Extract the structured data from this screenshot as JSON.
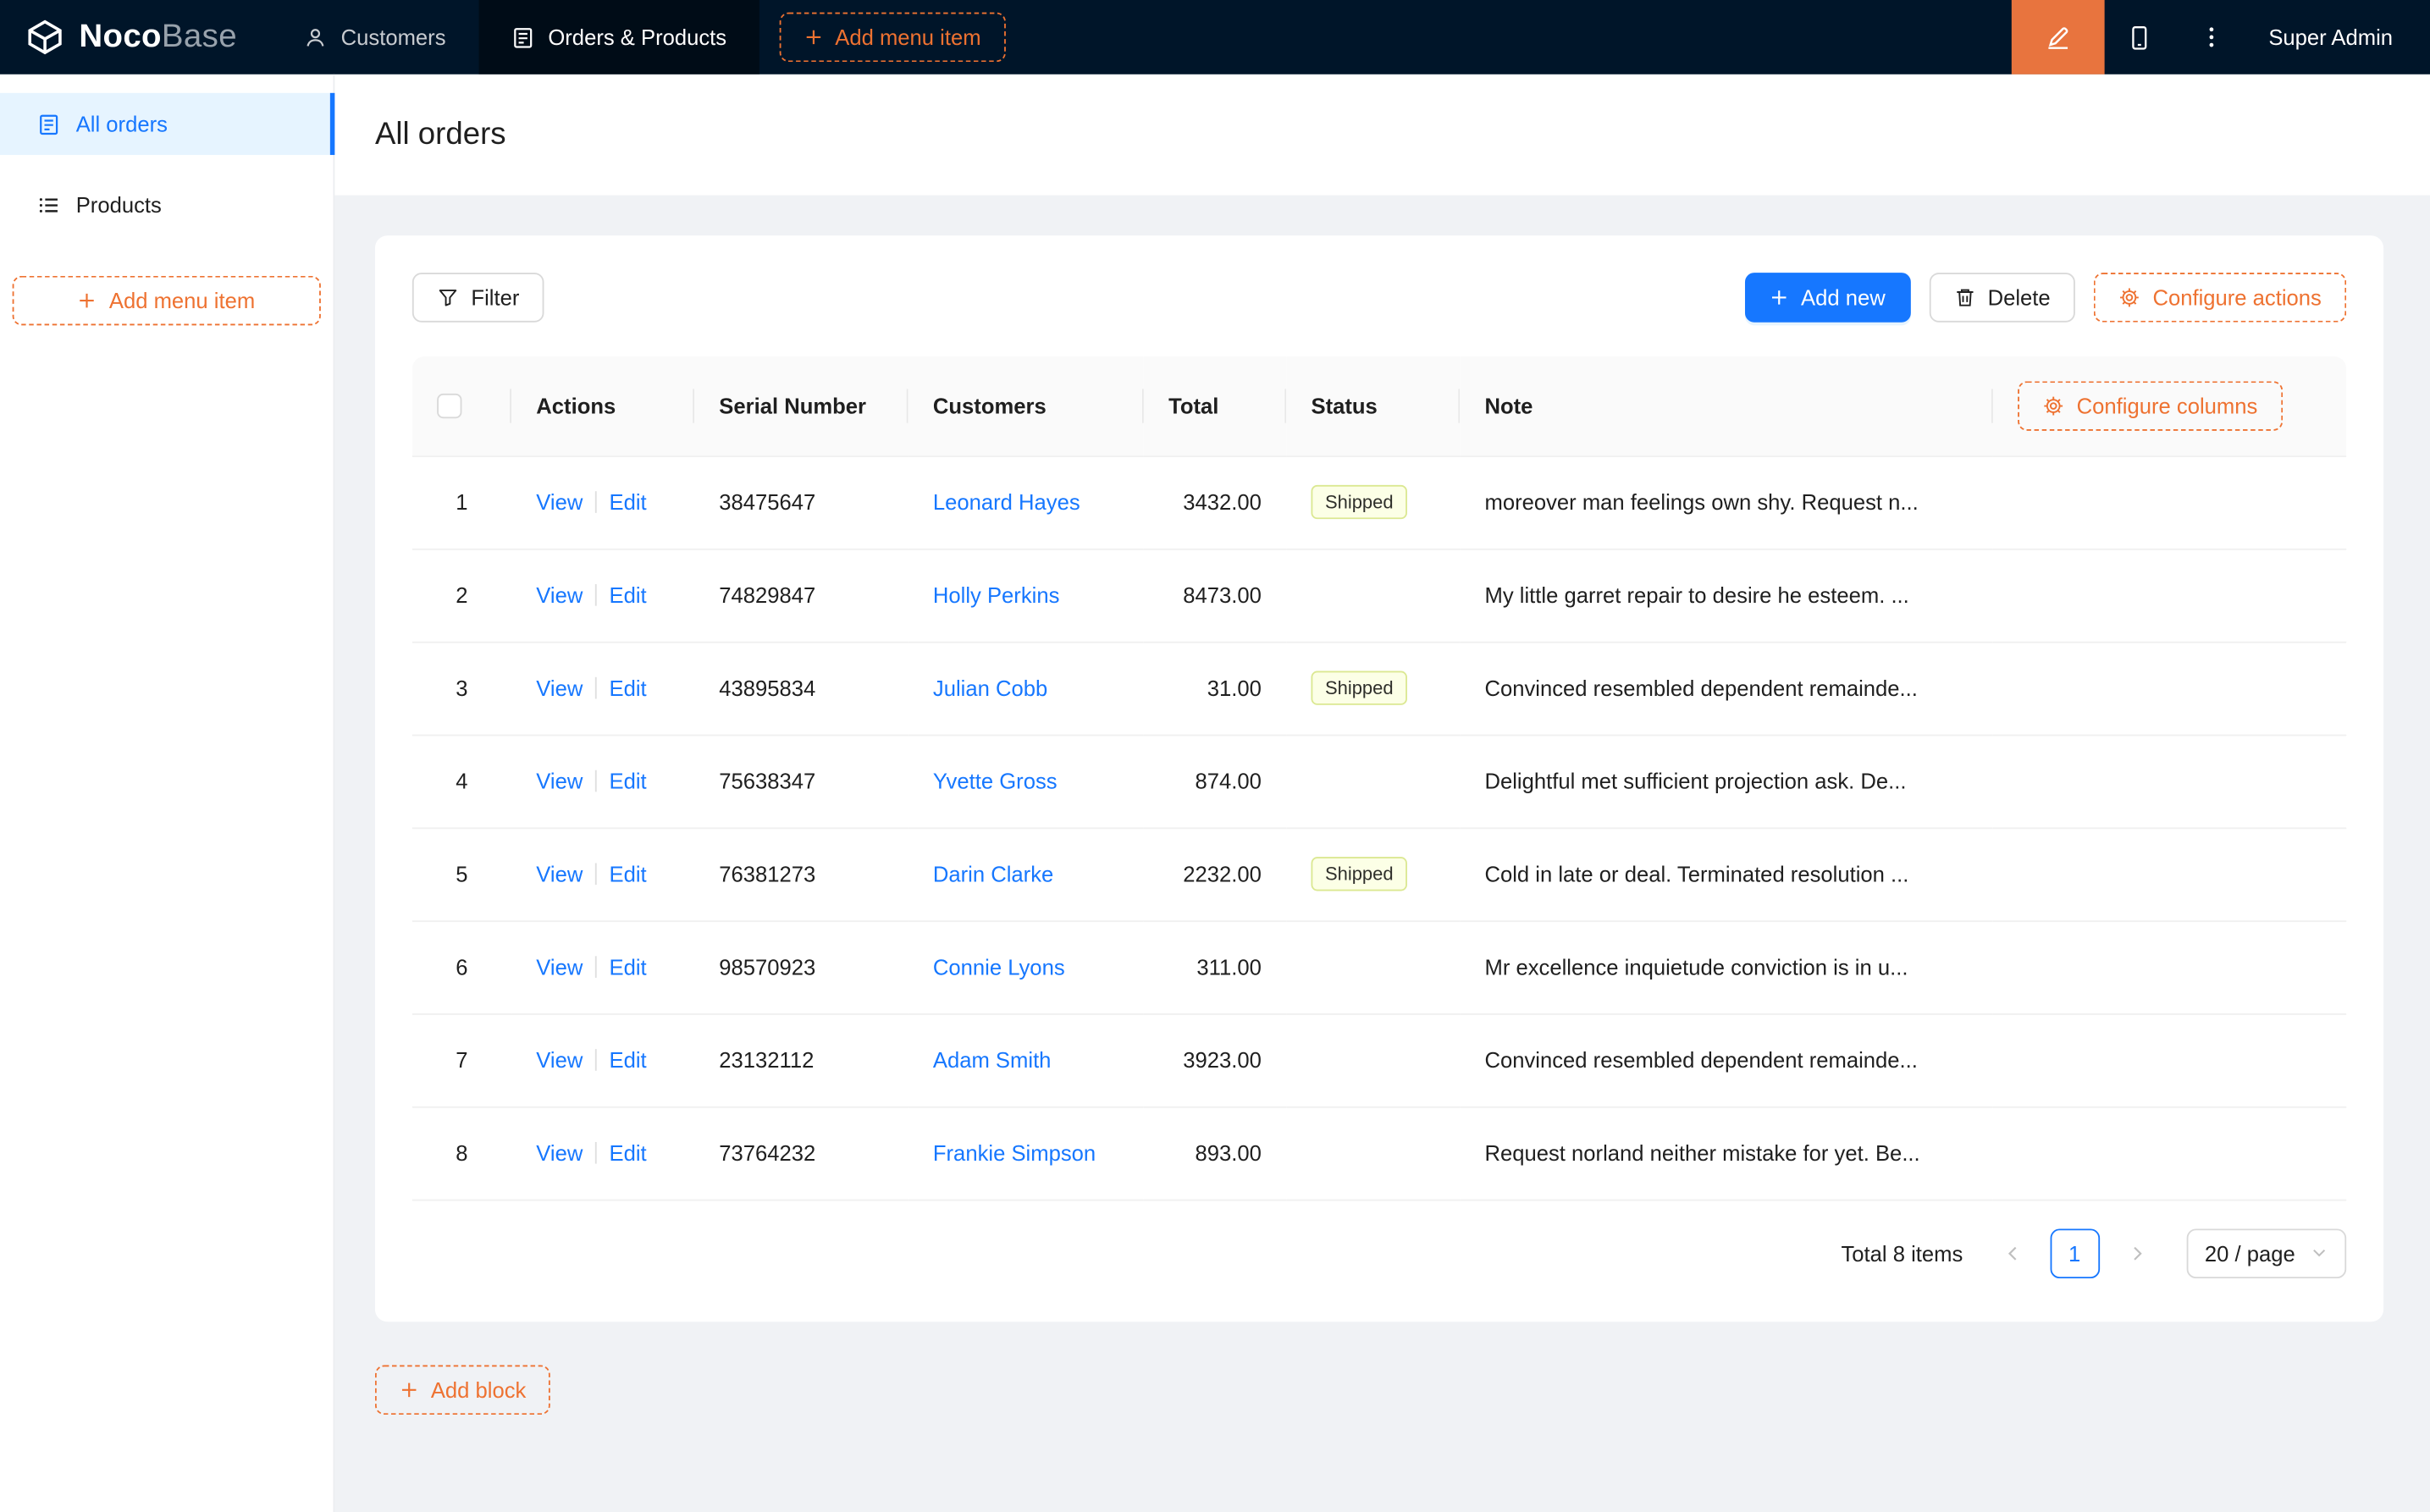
{
  "topbar": {
    "logo_bold": "Noco",
    "logo_light": "Base",
    "menu": [
      {
        "label": "Customers"
      },
      {
        "label": "Orders & Products"
      }
    ],
    "add_menu_item_label": "Add menu item",
    "user_name": "Super Admin"
  },
  "sidebar": {
    "items": [
      {
        "label": "All orders"
      },
      {
        "label": "Products"
      }
    ],
    "add_menu_item_label": "Add menu item"
  },
  "page": {
    "title": "All orders"
  },
  "toolbar": {
    "filter_label": "Filter",
    "add_new_label": "Add new",
    "delete_label": "Delete",
    "configure_actions_label": "Configure actions"
  },
  "table": {
    "configure_columns_label": "Configure columns",
    "columns": [
      "Actions",
      "Serial Number",
      "Customers",
      "Total",
      "Status",
      "Note"
    ],
    "labels": {
      "view": "View",
      "edit": "Edit"
    },
    "rows": [
      {
        "index": "1",
        "serial": "38475647",
        "customer": "Leonard Hayes",
        "total": "3432.00",
        "status": "Shipped",
        "note": "moreover man feelings own shy. Request n..."
      },
      {
        "index": "2",
        "serial": "74829847",
        "customer": "Holly Perkins",
        "total": "8473.00",
        "status": "",
        "note": "My little garret repair to desire he esteem. ..."
      },
      {
        "index": "3",
        "serial": "43895834",
        "customer": "Julian Cobb",
        "total": "31.00",
        "status": "Shipped",
        "note": "Convinced resembled dependent remainde..."
      },
      {
        "index": "4",
        "serial": "75638347",
        "customer": "Yvette Gross",
        "total": "874.00",
        "status": "",
        "note": "Delightful met sufficient projection ask. De..."
      },
      {
        "index": "5",
        "serial": "76381273",
        "customer": "Darin Clarke",
        "total": "2232.00",
        "status": "Shipped",
        "note": "Cold in late or deal. Terminated resolution ..."
      },
      {
        "index": "6",
        "serial": "98570923",
        "customer": "Connie Lyons",
        "total": "311.00",
        "status": "",
        "note": "Mr excellence inquietude conviction is in u..."
      },
      {
        "index": "7",
        "serial": "23132112",
        "customer": "Adam Smith",
        "total": "3923.00",
        "status": "",
        "note": "Convinced resembled dependent remainde..."
      },
      {
        "index": "8",
        "serial": "73764232",
        "customer": "Frankie Simpson",
        "total": "893.00",
        "status": "",
        "note": "Request norland neither mistake for yet. Be..."
      }
    ]
  },
  "pagination": {
    "total_text": "Total 8 items",
    "current_page": "1",
    "page_size": "20 / page"
  },
  "footer": {
    "add_block_label": "Add block"
  },
  "colors": {
    "accent-orange": "#ee7231",
    "designer-orange": "#e8743e",
    "primary-blue": "#1677ff",
    "topbar-bg": "#001529",
    "topbar-active-bg": "#000c17",
    "sidebar-active-bg": "#e6f4ff",
    "content-bg": "#f0f2f5",
    "header-bg": "#fafafa",
    "tag-bg": "#fcffe6",
    "tag-border": "#dbe892"
  }
}
